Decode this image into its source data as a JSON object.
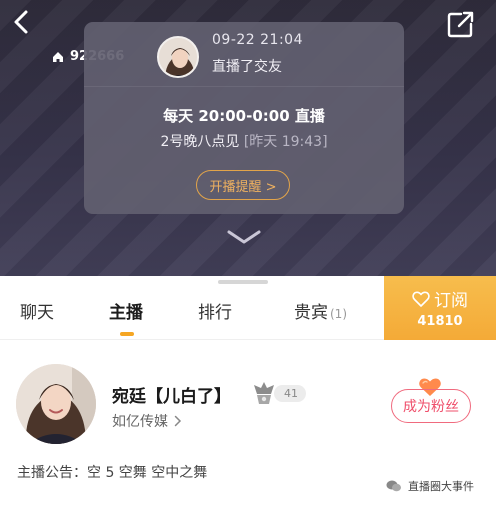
{
  "header": {
    "room_id": "922666",
    "icons": {
      "back": "back-arrow-icon",
      "share": "share-icon",
      "home": "home-icon"
    }
  },
  "notice_card": {
    "time": "09-22 21:04",
    "status": "直播了交友",
    "schedule": "每天 20:00-0:00 直播",
    "sub_text": "2号晚八点见",
    "sub_time": "[昨天 19:43]",
    "remind_label": "开播提醒 >"
  },
  "tabs": [
    {
      "label": "聊天"
    },
    {
      "label": "主播",
      "active": true
    },
    {
      "label": "排行"
    },
    {
      "label": "贵宾",
      "count": "(1)"
    }
  ],
  "subscribe": {
    "label": "订阅",
    "count": "41810",
    "color": "#f4aa37"
  },
  "streamer": {
    "name": "宛廷【儿白了】",
    "level": "41",
    "agency": "如亿传媒",
    "fan_button": "成为粉丝",
    "announcement": "主播公告：空 5 空舞 空中之舞"
  },
  "watermark": {
    "text": "直播圈大事件"
  },
  "colors": {
    "accent": "#f5a623",
    "fan": "#ef4f6b",
    "video_bg": "#36334a"
  }
}
